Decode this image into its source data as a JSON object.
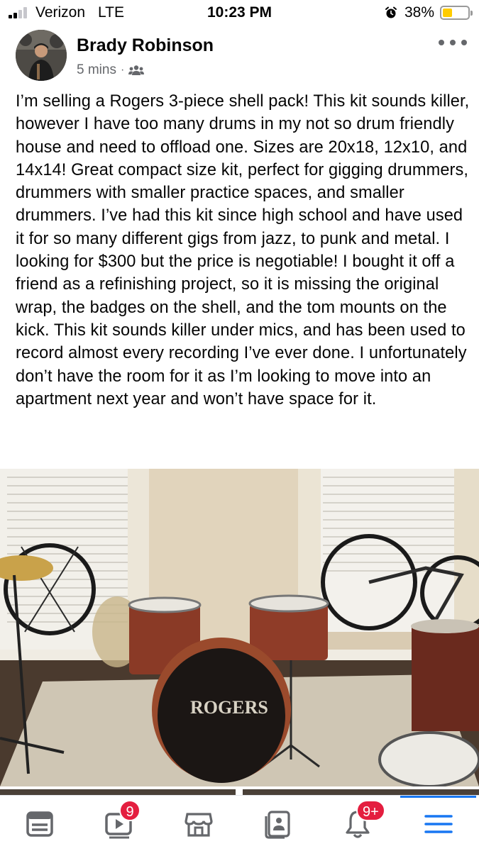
{
  "status_bar": {
    "carrier": "Verizon",
    "network": "LTE",
    "time": "10:23 PM",
    "battery_percent": "38%",
    "battery_level": 0.38,
    "signal_bars_filled": 2,
    "signal_bars_total": 4,
    "icons": [
      "signal-icon",
      "alarm-icon",
      "battery-icon"
    ]
  },
  "post": {
    "author": "Brady Robinson",
    "time_ago": "5 mins",
    "separator": "·",
    "audience_icon": "friends-icon",
    "body": "I’m selling a Rogers 3-piece shell pack! This kit sounds killer, however I have too many drums in my not so drum friendly house and need to offload one. Sizes are 20x18, 12x10, and 14x14! Great compact size kit, perfect for gigging drummers, drummers with smaller practice spaces, and smaller drummers. I’ve had this kit since high school and have used it for so many different gigs from jazz, to punk and metal. I looking for $300 but the price is negotiable! I bought it off a friend as a refinishing project, so it is missing the original wrap, the badges on the shell, and the tom mounts on the kick. This kit sounds killer under mics, and has been used to record almost every recording I’ve ever done. I unfortunately don’t have the room for it as I’m looking to move into an apartment next year and won’t have space for it.",
    "photo_bass_drum_logo": "ROGERS"
  },
  "tabbar": {
    "items": [
      {
        "icon": "news-feed-icon",
        "badge": ""
      },
      {
        "icon": "watch-video-icon",
        "badge": "9"
      },
      {
        "icon": "marketplace-icon",
        "badge": ""
      },
      {
        "icon": "pages-icon",
        "badge": ""
      },
      {
        "icon": "notifications-bell-icon",
        "badge": "9+"
      },
      {
        "icon": "menu-icon",
        "badge": ""
      }
    ],
    "active_index": 5,
    "accent_color": "#1877f2",
    "badge_color": "#e41e3f",
    "icon_color": "#65676b"
  }
}
